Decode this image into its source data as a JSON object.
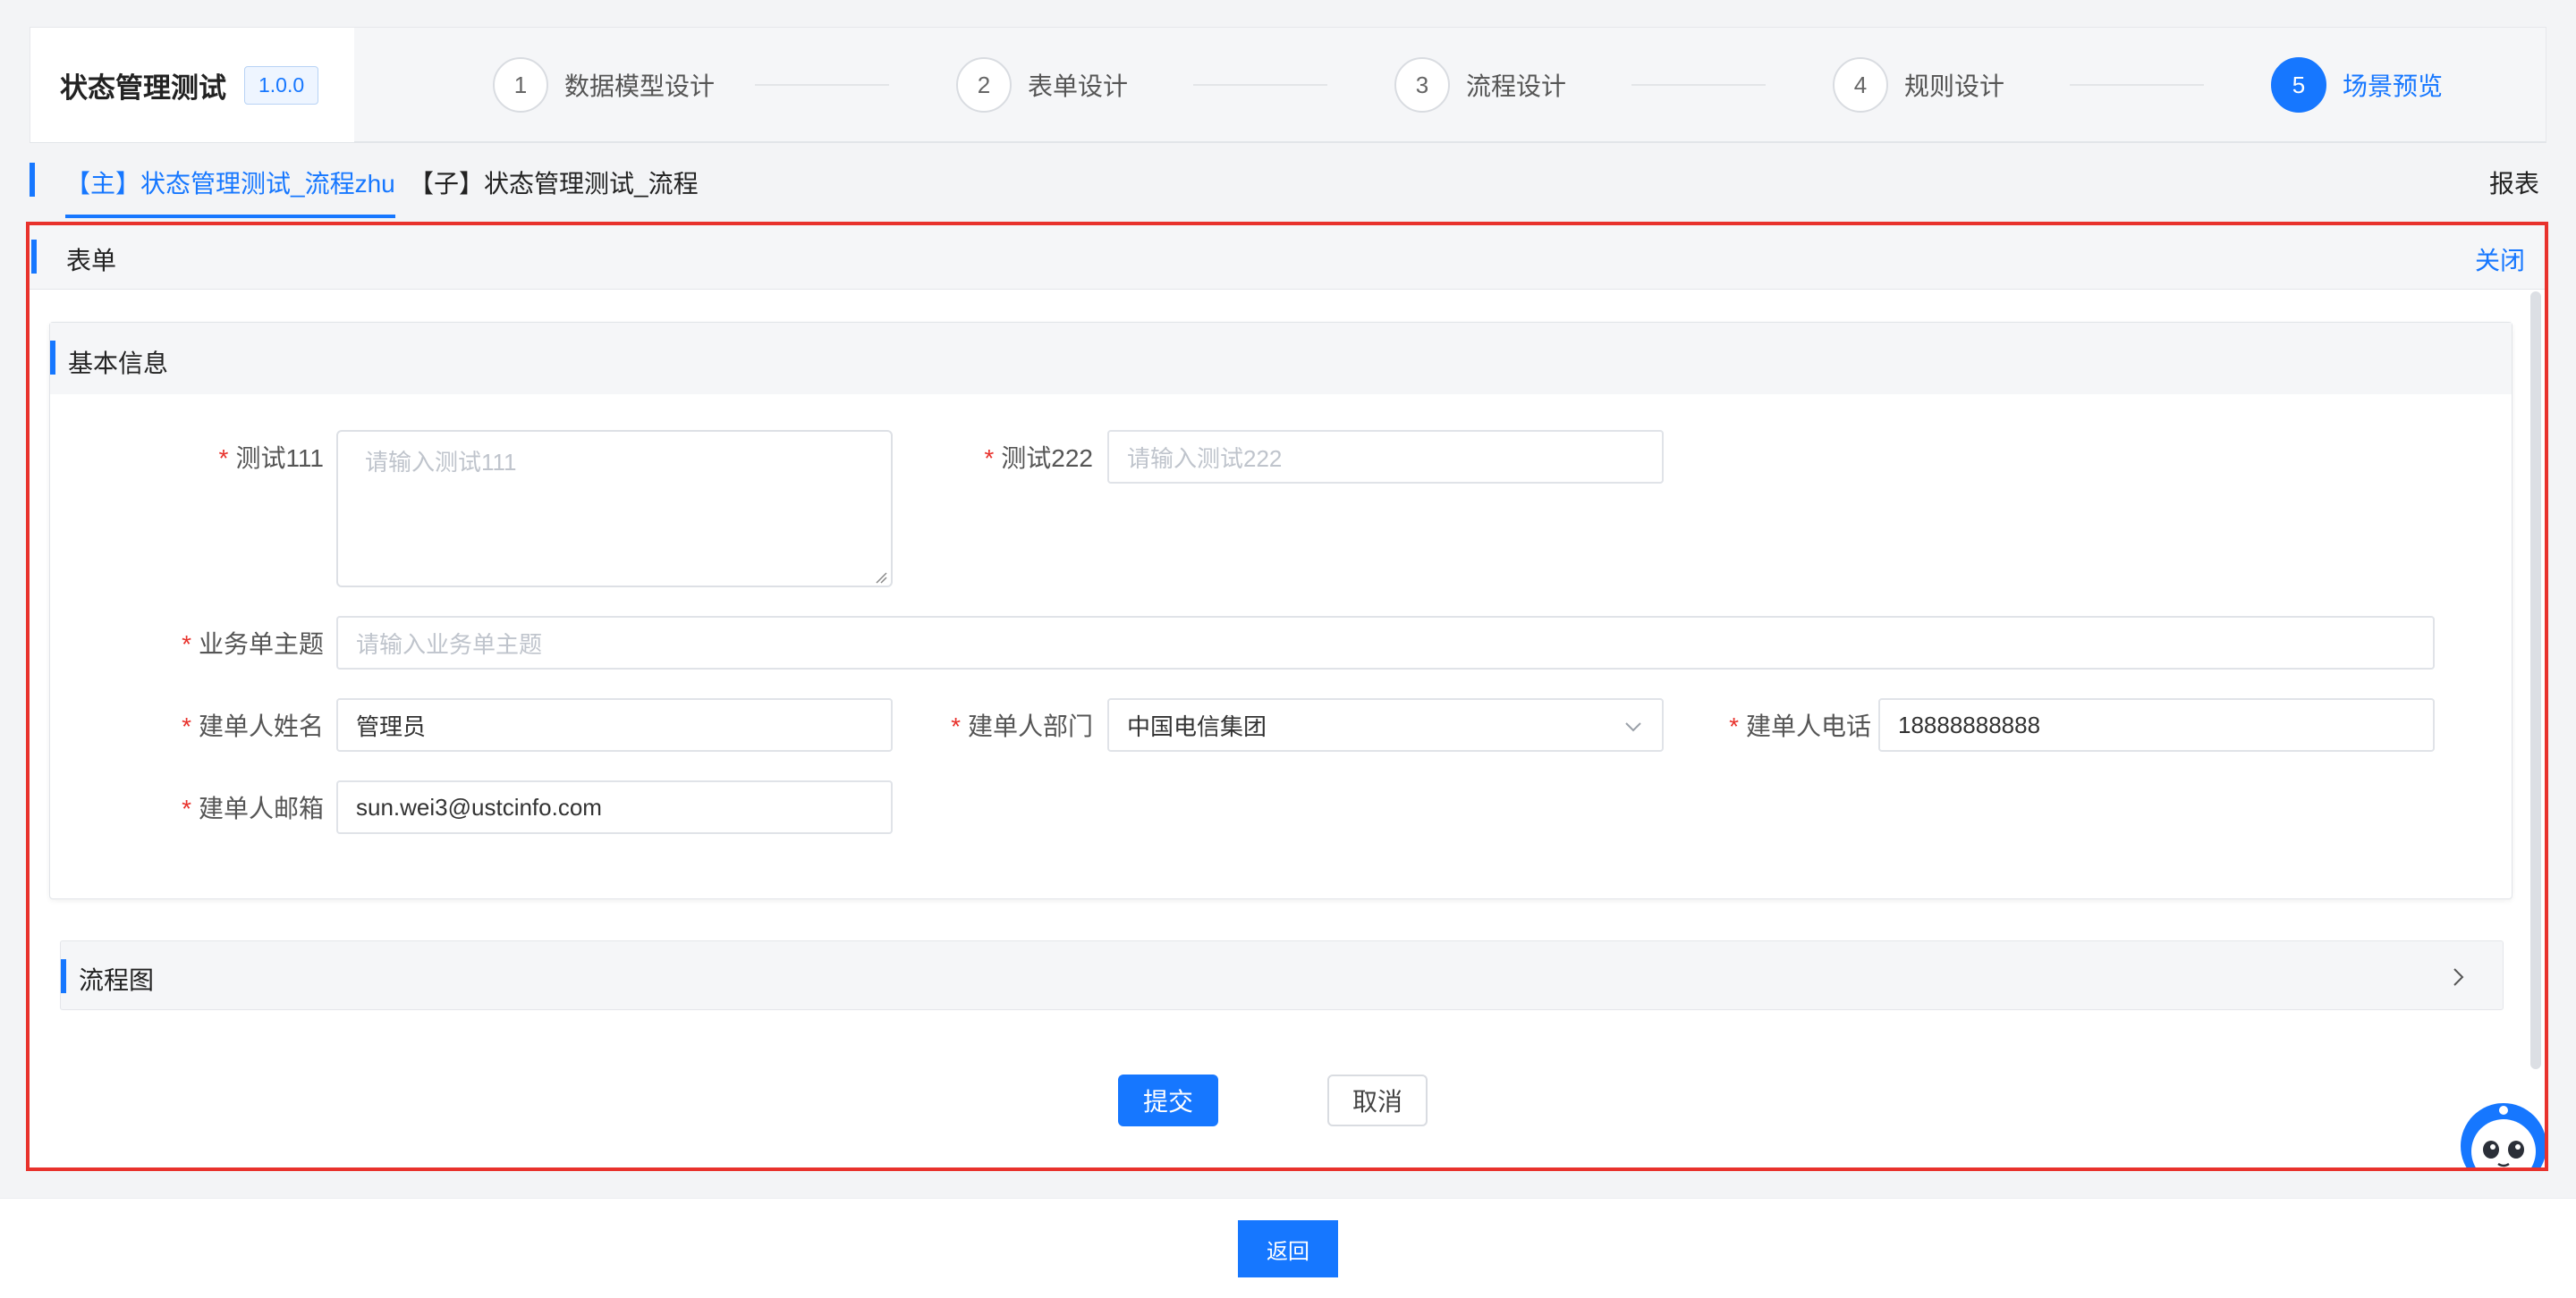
{
  "header": {
    "app_title": "状态管理测试",
    "version": "1.0.0",
    "steps": [
      {
        "num": "1",
        "label": "数据模型设计"
      },
      {
        "num": "2",
        "label": "表单设计"
      },
      {
        "num": "3",
        "label": "流程设计"
      },
      {
        "num": "4",
        "label": "规则设计"
      },
      {
        "num": "5",
        "label": "场景预览"
      }
    ],
    "active_step": "5"
  },
  "tabs": {
    "items": [
      {
        "label": "【主】状态管理测试_流程zhu",
        "active": true
      },
      {
        "label": "【子】状态管理测试_流程",
        "active": false
      }
    ],
    "report_link": "报表"
  },
  "form_panel": {
    "title": "表单",
    "close_label": "关闭",
    "section_title": "基本信息",
    "required_mark": "*",
    "fields": {
      "test111": {
        "label": "测试111",
        "placeholder": "请输入测试111",
        "value": ""
      },
      "test222": {
        "label": "测试222",
        "placeholder": "请输入测试222",
        "value": ""
      },
      "subject": {
        "label": "业务单主题",
        "placeholder": "请输入业务单主题",
        "value": ""
      },
      "creator_name": {
        "label": "建单人姓名",
        "value": "管理员"
      },
      "creator_dept": {
        "label": "建单人部门",
        "value": "中国电信集团"
      },
      "creator_phone": {
        "label": "建单人电话",
        "value": "18888888888"
      },
      "creator_email": {
        "label": "建单人邮箱",
        "value": "sun.wei3@ustcinfo.com"
      }
    },
    "flow_section_title": "流程图",
    "submit_label": "提交",
    "cancel_label": "取消"
  },
  "footer": {
    "back_label": "返回"
  },
  "colors": {
    "accent": "#1677ff",
    "highlight_border": "#e8322c",
    "required": "#e8322c"
  },
  "icons": [
    "chevron-down-icon",
    "chevron-right-icon",
    "resize-handle-icon",
    "assistant-robot-icon"
  ]
}
